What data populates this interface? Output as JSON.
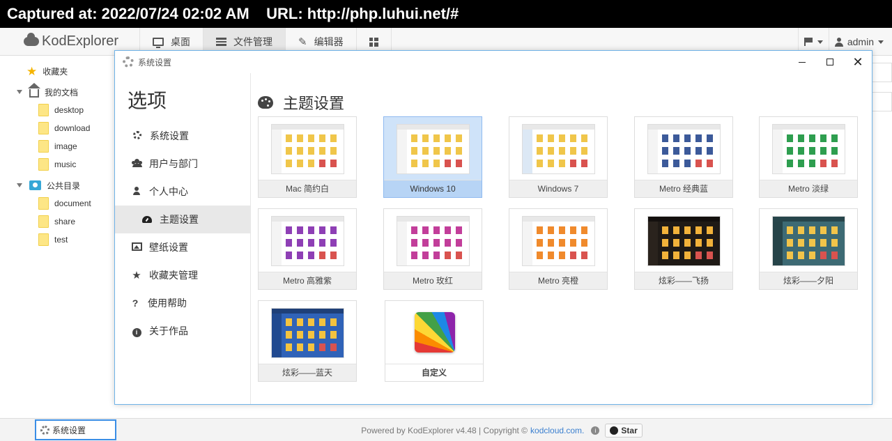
{
  "caption": "Captured at: 2022/07/24 02:02 AM    URL: http://php.luhui.net/#",
  "app": {
    "logo": "KodExplorer",
    "tabs": [
      {
        "label": "桌面"
      },
      {
        "label": "文件管理"
      },
      {
        "label": "编辑器"
      }
    ],
    "user": "admin"
  },
  "tree": {
    "favorites": "收藏夹",
    "my_docs": "我的文档",
    "my_docs_children": [
      "desktop",
      "download",
      "image",
      "music"
    ],
    "public": "公共目录",
    "public_children": [
      "document",
      "share",
      "test"
    ]
  },
  "dialog": {
    "title": "系统设置",
    "sidebar_title": "选项",
    "menu": [
      {
        "label": "系统设置"
      },
      {
        "label": "用户与部门"
      },
      {
        "label": "个人中心"
      },
      {
        "label": "主题设置"
      },
      {
        "label": "壁纸设置"
      },
      {
        "label": "收藏夹管理"
      },
      {
        "label": "使用帮助"
      },
      {
        "label": "关于作品"
      }
    ],
    "section_title": "主题设置",
    "themes": [
      {
        "label": "Mac 简约白"
      },
      {
        "label": "Windows 10"
      },
      {
        "label": "Windows 7"
      },
      {
        "label": "Metro 经典蓝"
      },
      {
        "label": "Metro 淡绿"
      },
      {
        "label": "Metro 高雅紫"
      },
      {
        "label": "Metro 玫红"
      },
      {
        "label": "Metro 亮橙"
      },
      {
        "label": "炫彩——飞扬"
      },
      {
        "label": "炫彩——夕阳"
      },
      {
        "label": "炫彩——蓝天"
      },
      {
        "label": "自定义"
      }
    ],
    "selected_theme": "Windows 10"
  },
  "footer": {
    "text": "Powered by KodExplorer v4.48 | Copyright ©",
    "link": "kodcloud.com.",
    "star": "Star"
  },
  "taskbar": {
    "item": "系统设置"
  },
  "colors": {
    "accent": "#3a8ee6",
    "selected_bg": "#cfe3f9",
    "folder": "#fde686"
  }
}
